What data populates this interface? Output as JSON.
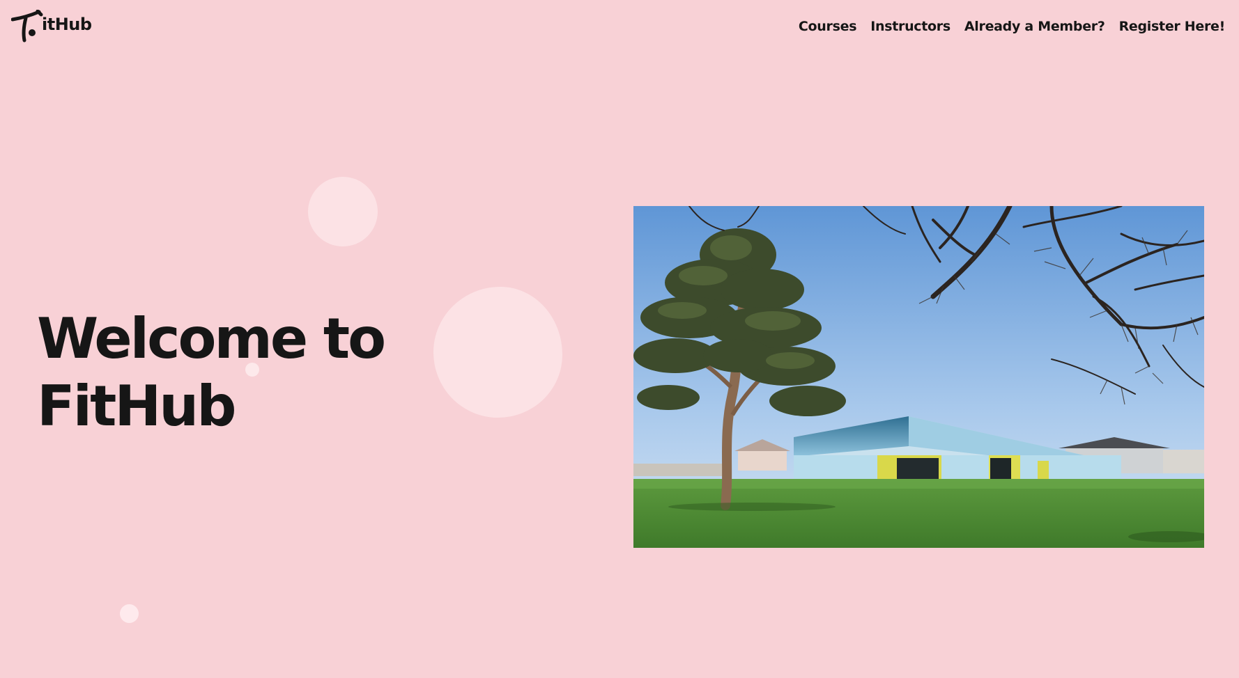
{
  "header": {
    "logo_text": "itHub",
    "nav": [
      "Courses",
      "Instructors",
      "Already a Member?",
      "Register Here!"
    ]
  },
  "hero": {
    "title_line1": "Welcome to",
    "title_line2": "FitHub",
    "image_description": "gym-building-photo"
  },
  "colors": {
    "background": "#f8d1d6",
    "text": "#161616",
    "bubble": "#fbe4e7"
  }
}
